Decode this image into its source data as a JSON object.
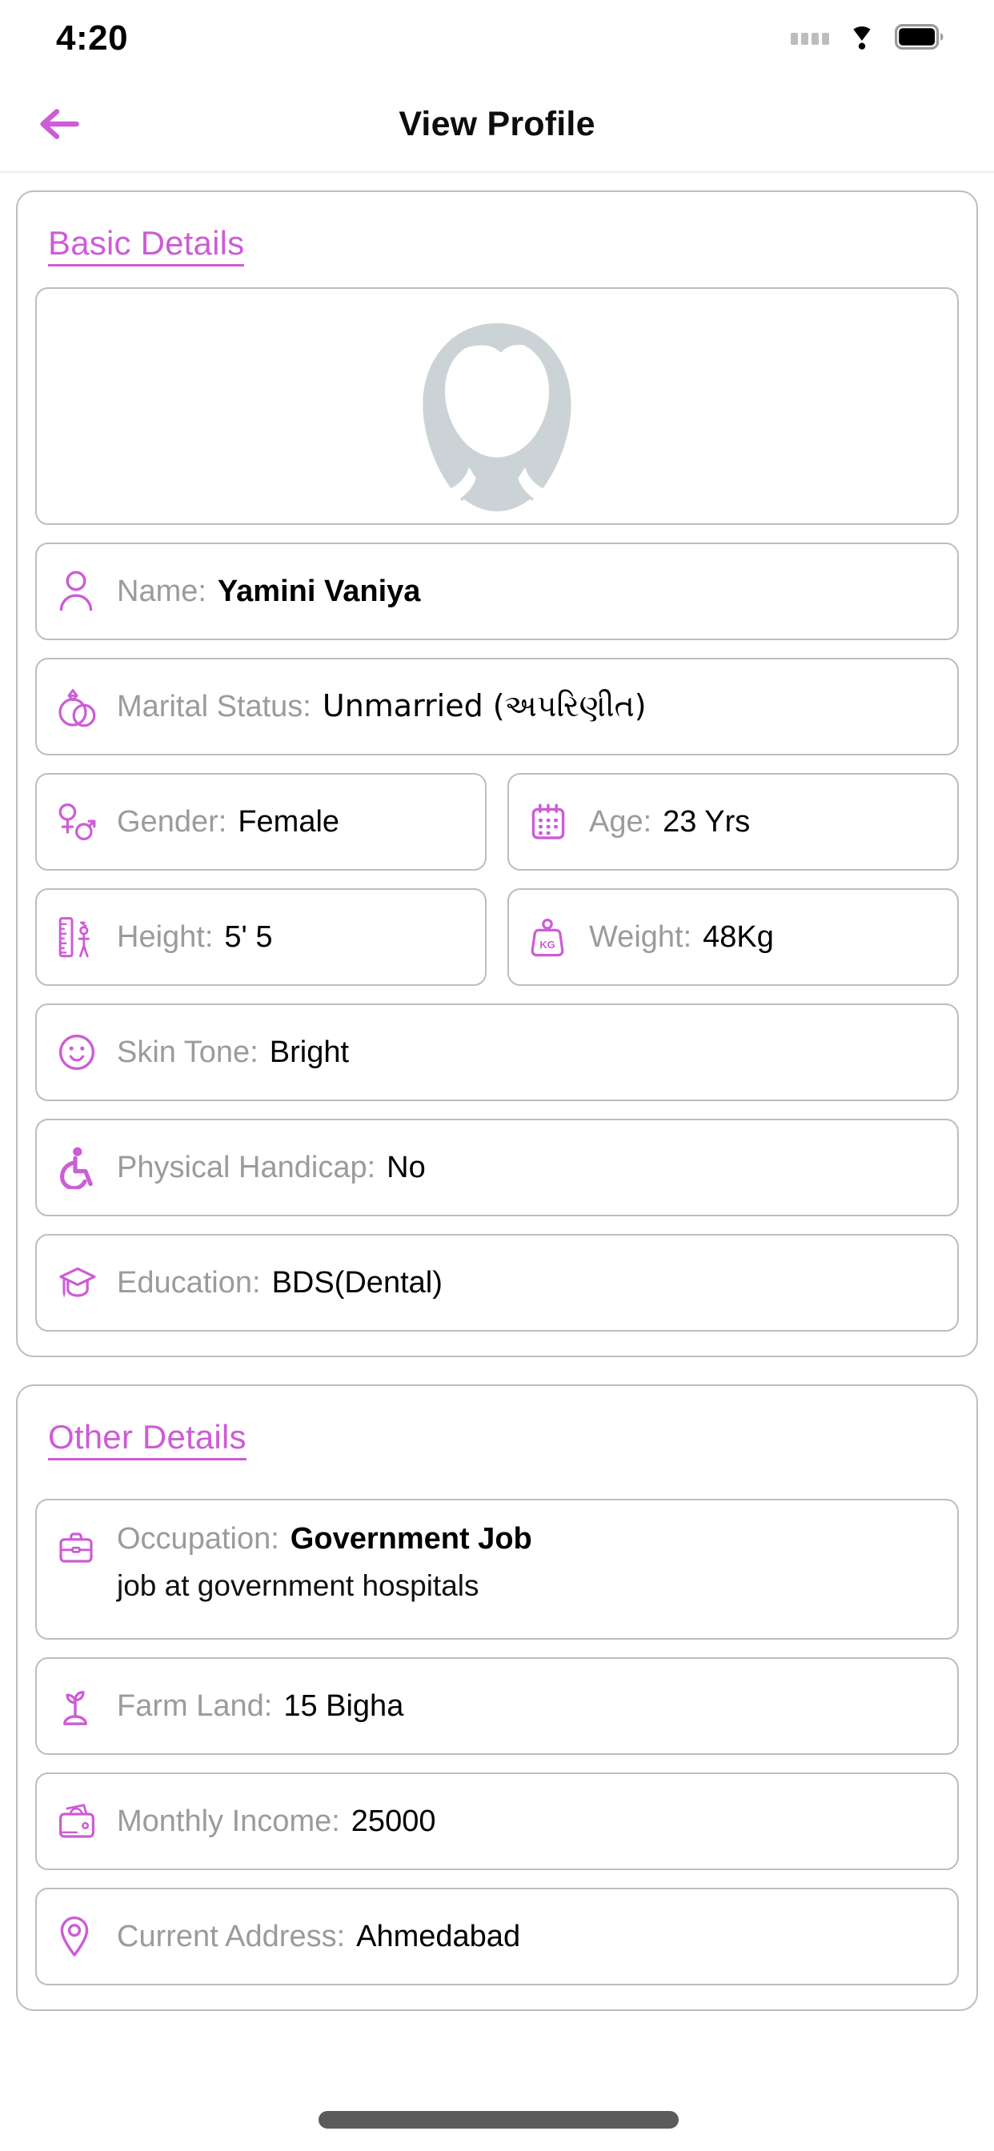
{
  "status_bar": {
    "time": "4:20",
    "icons": [
      "signal-dots-icon",
      "wifi-icon",
      "battery-icon"
    ]
  },
  "header": {
    "title": "View Profile",
    "back_icon": "arrow-left-icon"
  },
  "theme": {
    "accent": "#cd5cd6",
    "label_gray": "#9b9b9b",
    "border_gray": "#bdbdbd",
    "value_black": "#000000"
  },
  "basic_details": {
    "section_title": "Basic Details",
    "photo": {
      "icon": "avatar-placeholder-icon",
      "alt": "female avatar placeholder"
    },
    "fields": [
      {
        "icon": "person-icon",
        "label": "Name:",
        "value": "Yamini Vaniya",
        "bold": true
      },
      {
        "icon": "wedding-rings-icon",
        "label": "Marital Status:",
        "value": "Unmarried (અપરિણીત)",
        "bold": false
      },
      {
        "icon": "gender-icon",
        "label": "Gender:",
        "value": "Female",
        "bold": false
      },
      {
        "icon": "calendar-icon",
        "label": "Age:",
        "value": "23 Yrs",
        "bold": false
      },
      {
        "icon": "ruler-height-icon",
        "label": "Height:",
        "value": "5' 5",
        "bold": false
      },
      {
        "icon": "weight-kg-icon",
        "label": "Weight:",
        "value": "48Kg",
        "bold": false
      },
      {
        "icon": "smiley-face-icon",
        "label": "Skin Tone:",
        "value": "Bright",
        "bold": false
      },
      {
        "icon": "wheelchair-icon",
        "label": "Physical Handicap:",
        "value": "No",
        "bold": false
      },
      {
        "icon": "graduation-cap-icon",
        "label": "Education:",
        "value": "BDS(Dental)",
        "bold": false
      }
    ]
  },
  "other_details": {
    "section_title": "Other Details",
    "fields": [
      {
        "icon": "briefcase-icon",
        "label": "Occupation:",
        "value": "Government Job",
        "bold": true,
        "subvalue": "job at government hospitals"
      },
      {
        "icon": "sprout-icon",
        "label": "Farm Land:",
        "value": "15 Bigha",
        "bold": false
      },
      {
        "icon": "wallet-icon",
        "label": "Monthly Income:",
        "value": "25000",
        "bold": false
      },
      {
        "icon": "location-pin-icon",
        "label": "Current Address:",
        "value": "Ahmedabad",
        "bold": false
      }
    ]
  }
}
